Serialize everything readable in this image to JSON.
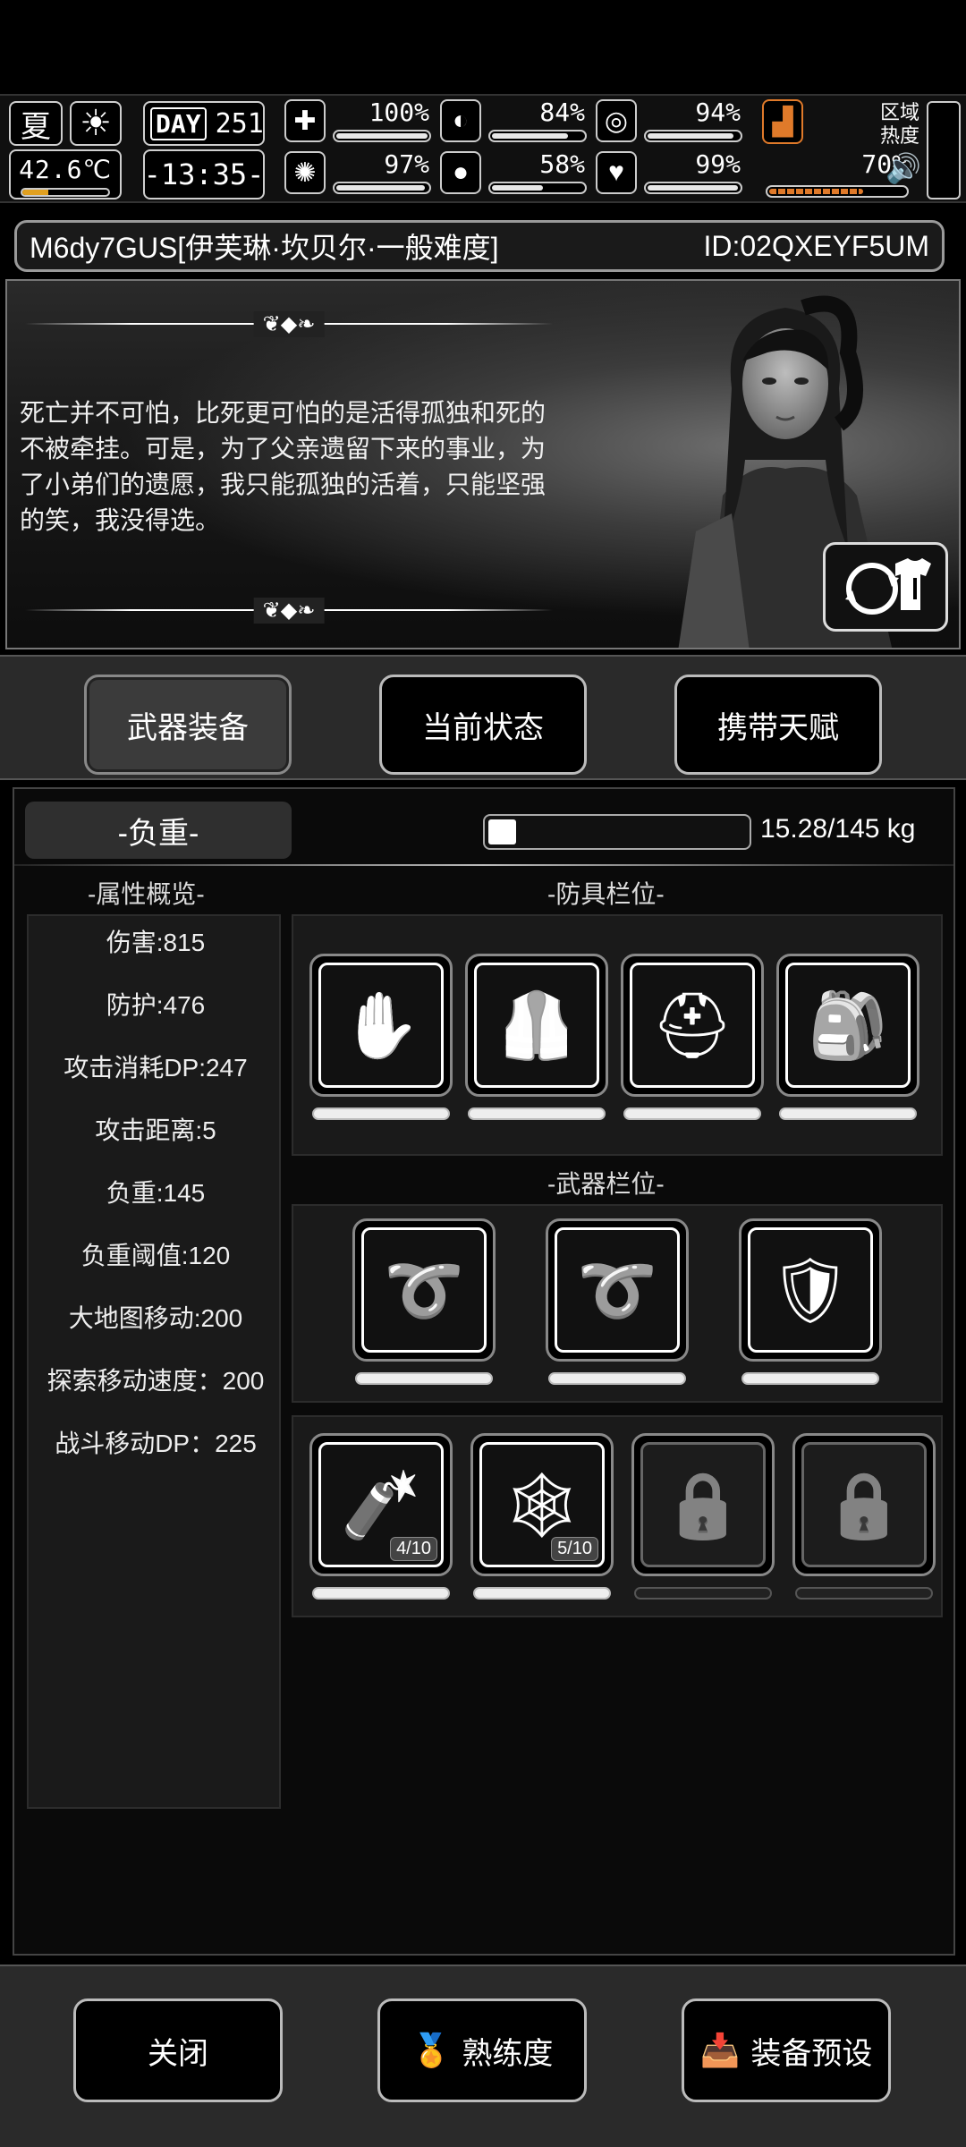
{
  "status": {
    "season": "夏",
    "temperature": "42.6℃",
    "temperature_level": 0.3,
    "day_label": "DAY",
    "day_number": "251",
    "time": "-13:35-",
    "stats": [
      {
        "icon": "medkit-icon",
        "glyph": "✚",
        "value": "100%",
        "level": 1.0
      },
      {
        "icon": "stomach-icon",
        "glyph": "◐",
        "value": "84%",
        "level": 0.84
      },
      {
        "icon": "lungs-icon",
        "glyph": "◎",
        "value": "94%",
        "level": 0.94
      },
      {
        "icon": "brain-icon",
        "glyph": "✺",
        "value": "97%",
        "level": 0.97
      },
      {
        "icon": "water-drop-icon",
        "glyph": "●",
        "value": "58%",
        "level": 0.58
      },
      {
        "icon": "heart-icon",
        "glyph": "♥",
        "value": "99%",
        "level": 0.99
      },
      {
        "icon": "boot-icon",
        "glyph": "▟",
        "value": "70%",
        "level": 0.7
      }
    ],
    "zone_heat_label": "区域\n热度",
    "speaker_glyph": "🔊",
    "orange": "#e07a2a"
  },
  "character": {
    "name": "M6dy7GUS[伊芙琳·坎贝尔·一般难度]",
    "id": "ID:02QXEYF5UM",
    "quote": "死亡并不可怕，比死更可怕的是活得孤独和死的不被牵挂。可是，为了父亲遗留下来的事业，为了小弟们的遗愿，我只能孤独的活着，只能坚强的笑，我没得选。"
  },
  "tabs": [
    {
      "label": "武器装备",
      "active": true
    },
    {
      "label": "当前状态",
      "active": false
    },
    {
      "label": "携带天赋",
      "active": false
    }
  ],
  "load": {
    "title": "-负重-",
    "value_text": "15.28/145 kg",
    "fraction": 0.105
  },
  "attributes": {
    "title": "-属性概览-",
    "items": [
      "伤害:815",
      "防护:476",
      "攻击消耗DP:247",
      "攻击距离:5",
      "负重:145",
      "负重阈值:120",
      "大地图移动:200",
      "探索移动速度：200",
      "战斗移动DP：225"
    ]
  },
  "armor": {
    "title": "-防具栏位-",
    "slots": [
      {
        "icon": "gloves-icon",
        "glyph": "✋"
      },
      {
        "icon": "vest-icon",
        "glyph": "🦺"
      },
      {
        "icon": "helmet-icon",
        "glyph": "⛑"
      },
      {
        "icon": "backpack-icon",
        "glyph": "🎒"
      }
    ]
  },
  "weapons": {
    "title": "-武器栏位-",
    "slots": [
      {
        "icon": "chain-whip-icon",
        "glyph": "➰"
      },
      {
        "icon": "chain-whip-icon",
        "glyph": "➰"
      },
      {
        "icon": "shield-icon",
        "glyph": "🛡"
      }
    ]
  },
  "items": {
    "slots": [
      {
        "icon": "grenade-icon",
        "glyph": "🧨",
        "count": "4/10",
        "locked": false
      },
      {
        "icon": "net-trap-icon",
        "glyph": "🕸",
        "count": "5/10",
        "locked": false
      },
      {
        "icon": "lock-icon",
        "glyph": "🔒",
        "count": "",
        "locked": true
      },
      {
        "icon": "lock-icon",
        "glyph": "🔒",
        "count": "",
        "locked": true
      }
    ]
  },
  "bottom": {
    "close": "关闭",
    "proficiency": "熟练度",
    "preset": "装备预设"
  }
}
